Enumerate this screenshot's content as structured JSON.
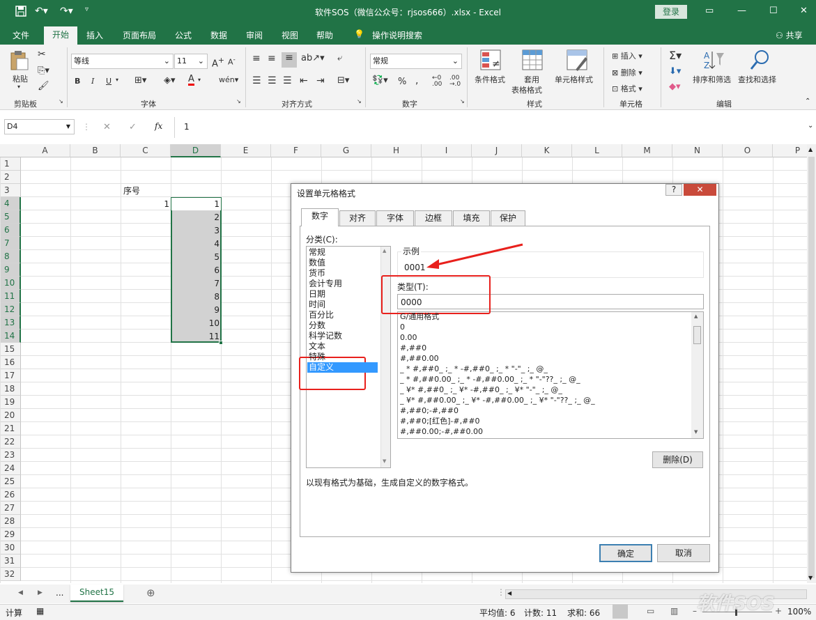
{
  "titlebar": {
    "title": "软件SOS（微信公众号：rjsos666）.xlsx  -  Excel",
    "login": "登录"
  },
  "menu": {
    "file": "文件",
    "home": "开始",
    "insert": "插入",
    "layout": "页面布局",
    "formulas": "公式",
    "data": "数据",
    "review": "审阅",
    "view": "视图",
    "help": "帮助",
    "tellme": "操作说明搜索",
    "share": "共享"
  },
  "ribbon": {
    "clipboard": {
      "paste": "粘贴",
      "label": "剪贴板"
    },
    "font": {
      "name": "等线",
      "size": "11",
      "label": "字体",
      "bold": "B",
      "italic": "I",
      "underline": "U"
    },
    "alignment": {
      "label": "对齐方式"
    },
    "number": {
      "format": "常规",
      "label": "数字",
      "percent": "%"
    },
    "styles": {
      "conditional": "条件格式",
      "table1": "套用",
      "table2": "表格格式",
      "cell_styles": "单元格样式",
      "label": "样式"
    },
    "cells": {
      "insert": "插入",
      "delete": "删除",
      "format": "格式",
      "label": "单元格"
    },
    "editing": {
      "sort": "排序和筛选",
      "find": "查找和选择",
      "label": "编辑"
    }
  },
  "formula_bar": {
    "name_box": "D4",
    "fx": "fx",
    "value": "1"
  },
  "columns": [
    "A",
    "B",
    "C",
    "D",
    "E",
    "F",
    "G",
    "H",
    "I",
    "J",
    "K",
    "L",
    "M",
    "N",
    "O",
    "P"
  ],
  "rows": [
    "1",
    "2",
    "3",
    "4",
    "5",
    "6",
    "7",
    "8",
    "9",
    "10",
    "11",
    "12",
    "13",
    "14",
    "15",
    "16",
    "17",
    "18",
    "19",
    "20",
    "21",
    "22",
    "23",
    "24",
    "25",
    "26",
    "27",
    "28",
    "29",
    "30",
    "31",
    "32"
  ],
  "cells": {
    "c3": "序号",
    "c4": "1",
    "d_values": [
      "1",
      "2",
      "3",
      "4",
      "5",
      "6",
      "7",
      "8",
      "9",
      "10",
      "11"
    ]
  },
  "dialog": {
    "title": "设置单元格格式",
    "help": "?",
    "tabs": [
      "数字",
      "对齐",
      "字体",
      "边框",
      "填充",
      "保护"
    ],
    "category_label": "分类(C):",
    "categories": [
      "常规",
      "数值",
      "货币",
      "会计专用",
      "日期",
      "时间",
      "百分比",
      "分数",
      "科学记数",
      "文本",
      "特殊",
      "自定义"
    ],
    "sample_label": "示例",
    "sample_value": "0001",
    "type_label": "类型(T):",
    "type_value": "0000",
    "formats": [
      "G/通用格式",
      "0",
      "0.00",
      "#,##0",
      "#,##0.00",
      "_ * #,##0_ ;_ * -#,##0_ ;_ * \"-\"_ ;_ @_",
      "_ * #,##0.00_ ;_ * -#,##0.00_ ;_ * \"-\"??_ ;_ @_",
      "_ ¥* #,##0_ ;_ ¥* -#,##0_ ;_ ¥* \"-\"_ ;_ @_",
      "_ ¥* #,##0.00_ ;_ ¥* -#,##0.00_ ;_ ¥* \"-\"??_ ;_ @_",
      "#,##0;-#,##0",
      "#,##0;[红色]-#,##0",
      "#,##0.00;-#,##0.00"
    ],
    "delete": "删除(D)",
    "description": "以现有格式为基础，生成自定义的数字格式。",
    "ok": "确定",
    "cancel": "取消"
  },
  "sheet": {
    "ellipsis": "...",
    "tab": "Sheet15"
  },
  "status": {
    "mode": "计算",
    "average": "平均值: 6",
    "count": "计数: 11",
    "sum": "求和: 66",
    "zoom": "100%"
  },
  "watermark": "软件SOS",
  "colors": {
    "excel_green": "#217346",
    "highlight": "#e8201c",
    "selection": "#d2d2d2",
    "list_selected": "#3399ff"
  }
}
